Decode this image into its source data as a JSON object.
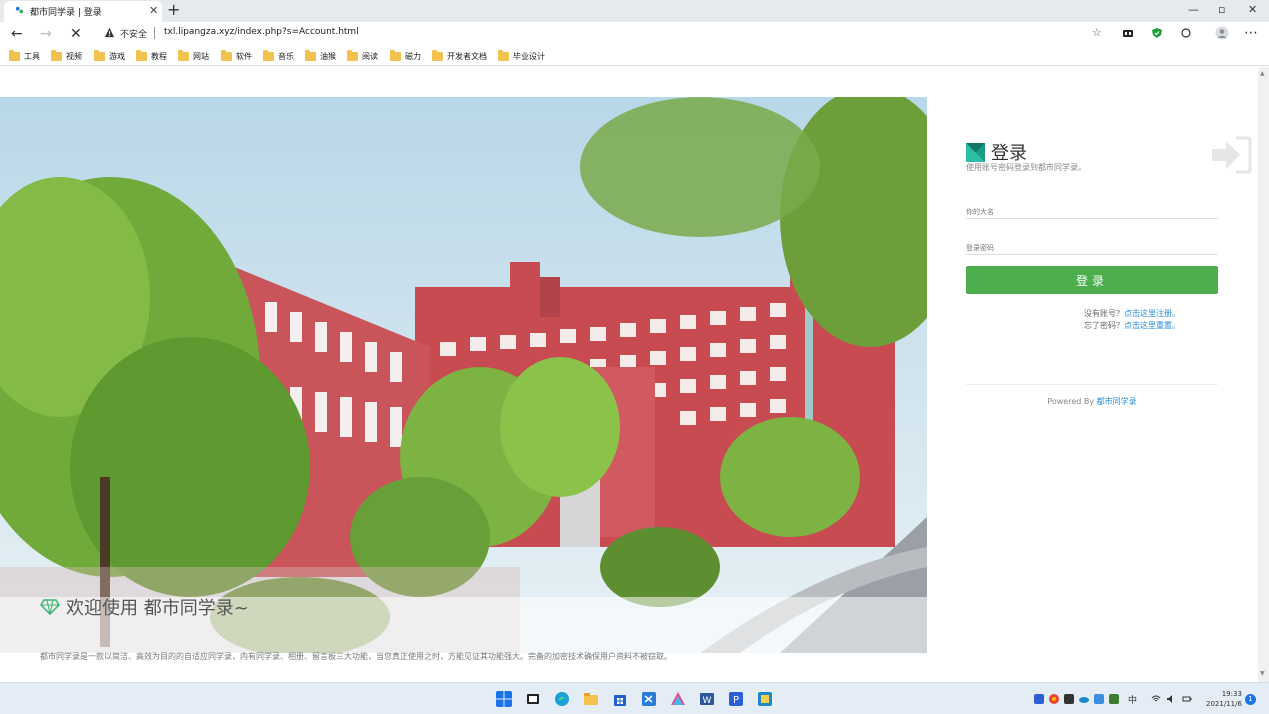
{
  "browser": {
    "tab_title": "都市同学录 | 登录",
    "close_glyph": "✕",
    "newtab_glyph": "+",
    "address_insecure": "不安全",
    "url": "txl.lipangza.xyz/index.php?s=Account.html",
    "bookmarks": [
      "工具",
      "视频",
      "游戏",
      "教程",
      "网站",
      "软件",
      "音乐",
      "油猴",
      "阅读",
      "磁力",
      "开发者文档",
      "毕业设计"
    ]
  },
  "hero": {
    "welcome": "欢迎使用 都市同学录~",
    "description": "都市同学录是一款以简洁、高效为目的的自适应同学录，内有同学录、相册、留言板三大功能，当您真正使用之时，方能见证其功能强大。完备的加密技术确保用户资料不被窃取。"
  },
  "login": {
    "title": "登录",
    "subtitle": "使用账号密码登录到都市同学录。",
    "name_placeholder": "你的大名",
    "password_placeholder": "登录密码",
    "button": "登录",
    "no_account": "没有账号？",
    "register_link": "点击这里注册。",
    "forgot": "忘了密码？",
    "reset_link": "点击这里重置。",
    "powered_by": "Powered By",
    "powered_link": "都市同学录"
  },
  "taskbar": {
    "ime": "中",
    "time": "19:33",
    "date": "2021/11/6",
    "notifications": "1"
  },
  "colors": {
    "login_button": "#4cae4c",
    "link": "#2b8de0",
    "building": "#c94b52"
  }
}
